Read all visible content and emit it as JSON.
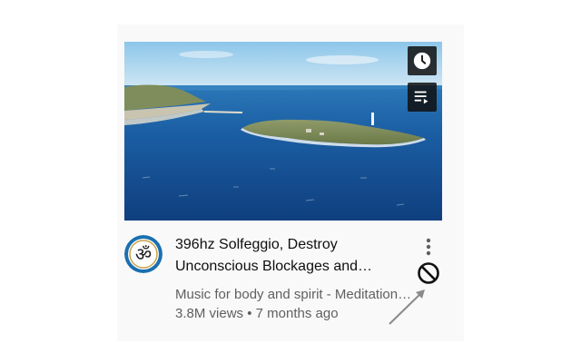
{
  "video": {
    "title_line1": "396hz Solfeggio, Destroy",
    "title_line2": "Unconscious Blockages and…",
    "channel": "Music for body and spirit - Meditation Music",
    "views": "3.8M views",
    "separator": "•",
    "age": "7 months ago"
  },
  "overlay_buttons": {
    "watch_later_icon": "clock-icon",
    "add_to_queue_icon": "queue-icon"
  },
  "avatar": {
    "symbol": "ॐ",
    "ring_color": "#1a6fb0"
  },
  "menu": {
    "icon": "vertical-dots-icon"
  },
  "annotation": {
    "icon": "block-icon",
    "arrow": "pointer-arrow"
  },
  "colors": {
    "title": "#0f0f0f",
    "secondary": "#606060",
    "card_background": "#f9f9f9"
  }
}
